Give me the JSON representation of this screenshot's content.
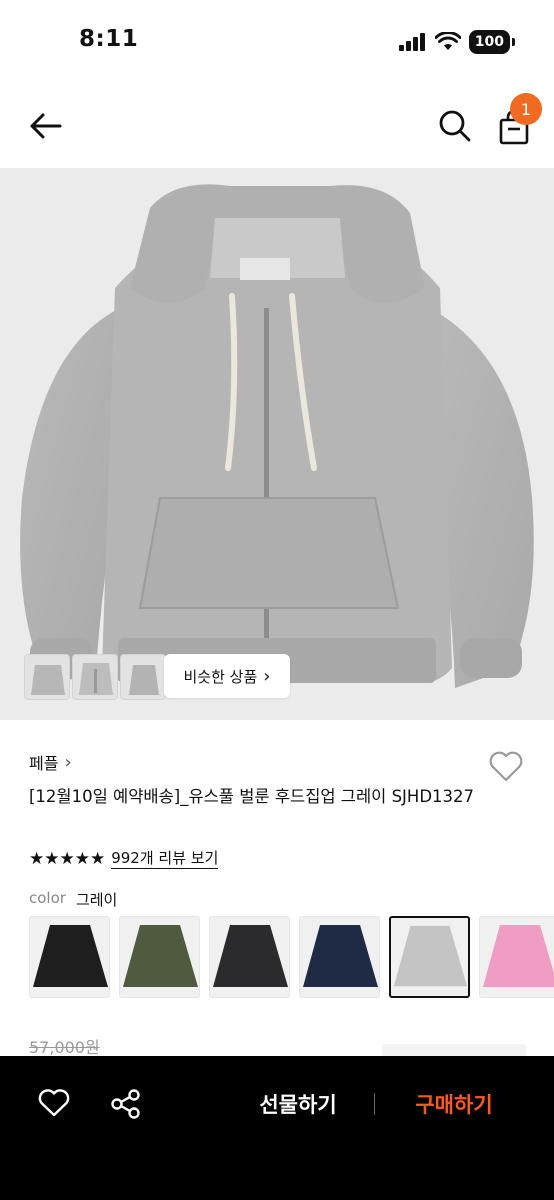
{
  "status_bar": {
    "time": "8:11",
    "battery": "100"
  },
  "top_nav": {
    "cart_count": "1"
  },
  "hero": {
    "similar_label": "비슷한 상품",
    "similar_chevron": "›"
  },
  "product": {
    "brand": "페플",
    "brand_chevron": "›",
    "title": "[12월10일 예약배송]_유스풀 벌룬 후드집업 그레이 SJHD1327",
    "stars": "★★★★★",
    "review_link": "992개 리뷰 보기",
    "color_label": "color",
    "color_value": "그레이",
    "swatch_colors": [
      "#1e1e1e",
      "#4f5a3f",
      "#2b2b2d",
      "#1f2a44",
      "#c4c4c4",
      "#ef9dc3"
    ],
    "original_price": "57,000원"
  },
  "bottom_bar": {
    "gift_label": "선물하기",
    "buy_label": "구매하기"
  },
  "colors": {
    "accent": "#ff5a1f",
    "badge": "#f06a22"
  }
}
